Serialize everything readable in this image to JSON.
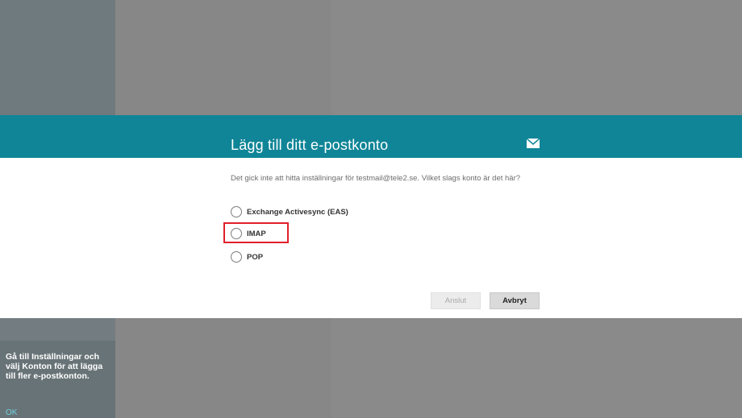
{
  "dialog": {
    "title": "Lägg till ditt e-postkonto",
    "message": "Det gick inte att hitta inställningar för testmail@tele2.se. Vilket slags konto är det här?",
    "options": [
      {
        "label": "Exchange Activesync (EAS)",
        "selected": false
      },
      {
        "label": "IMAP",
        "selected": false,
        "highlighted": true
      },
      {
        "label": "POP",
        "selected": false
      }
    ],
    "buttons": {
      "connect": "Anslut",
      "cancel": "Avbryt"
    }
  },
  "sidebar_tip": {
    "text": "Gå till Inställningar och välj Konton för att lägga till fler e-postkonton.",
    "ok": "OK"
  },
  "colors": {
    "header": "#0f8597",
    "highlight": "#e0202a",
    "tip_link": "#6fd0e0"
  }
}
